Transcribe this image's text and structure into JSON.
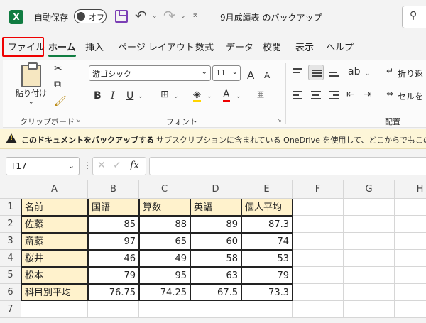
{
  "titlebar": {
    "autosave_label": "自動保存",
    "toggle_text": "オフ",
    "document_title": "9月成績表 のバックアップ"
  },
  "tabs": [
    "ファイル",
    "ホーム",
    "挿入",
    "ページ レイアウト",
    "数式",
    "データ",
    "校閲",
    "表示",
    "ヘルプ"
  ],
  "ribbon": {
    "paste_label": "貼り付け",
    "clipboard_label": "クリップボード",
    "font_name": "游ゴシック",
    "font_size": "11",
    "font_label": "フォント",
    "align_label": "配置",
    "wrap_label": "折り返",
    "merge_label": "セルを",
    "bold": "B",
    "italic": "I",
    "underline": "U",
    "font_color": "A",
    "grow": "A",
    "shrink": "A"
  },
  "warning": {
    "title": "このドキュメントをバックアップする",
    "message": "サブスクリプションに含まれている OneDrive を使用して、どこからでもこのファイルに"
  },
  "formula_bar": {
    "name_box": "T17",
    "fx": "fx",
    "formula": ""
  },
  "grid": {
    "columns": [
      "A",
      "B",
      "C",
      "D",
      "E",
      "F",
      "G",
      "H"
    ],
    "rows": [
      "1",
      "2",
      "3",
      "4",
      "5",
      "6",
      "7"
    ],
    "header_row": [
      "名前",
      "国語",
      "算数",
      "英語",
      "個人平均"
    ],
    "data": [
      [
        "佐藤",
        "85",
        "88",
        "89",
        "87.3"
      ],
      [
        "斎藤",
        "97",
        "65",
        "60",
        "74"
      ],
      [
        "桜井",
        "46",
        "49",
        "58",
        "53"
      ],
      [
        "松本",
        "79",
        "95",
        "63",
        "79"
      ],
      [
        "科目別平均",
        "76.75",
        "74.25",
        "67.5",
        "73.3"
      ]
    ]
  },
  "colors": {
    "accent": "#107c41",
    "highlight_border": "#e00000",
    "header_fill": "#fff2cc",
    "warning_bg": "#fdf6d8"
  }
}
